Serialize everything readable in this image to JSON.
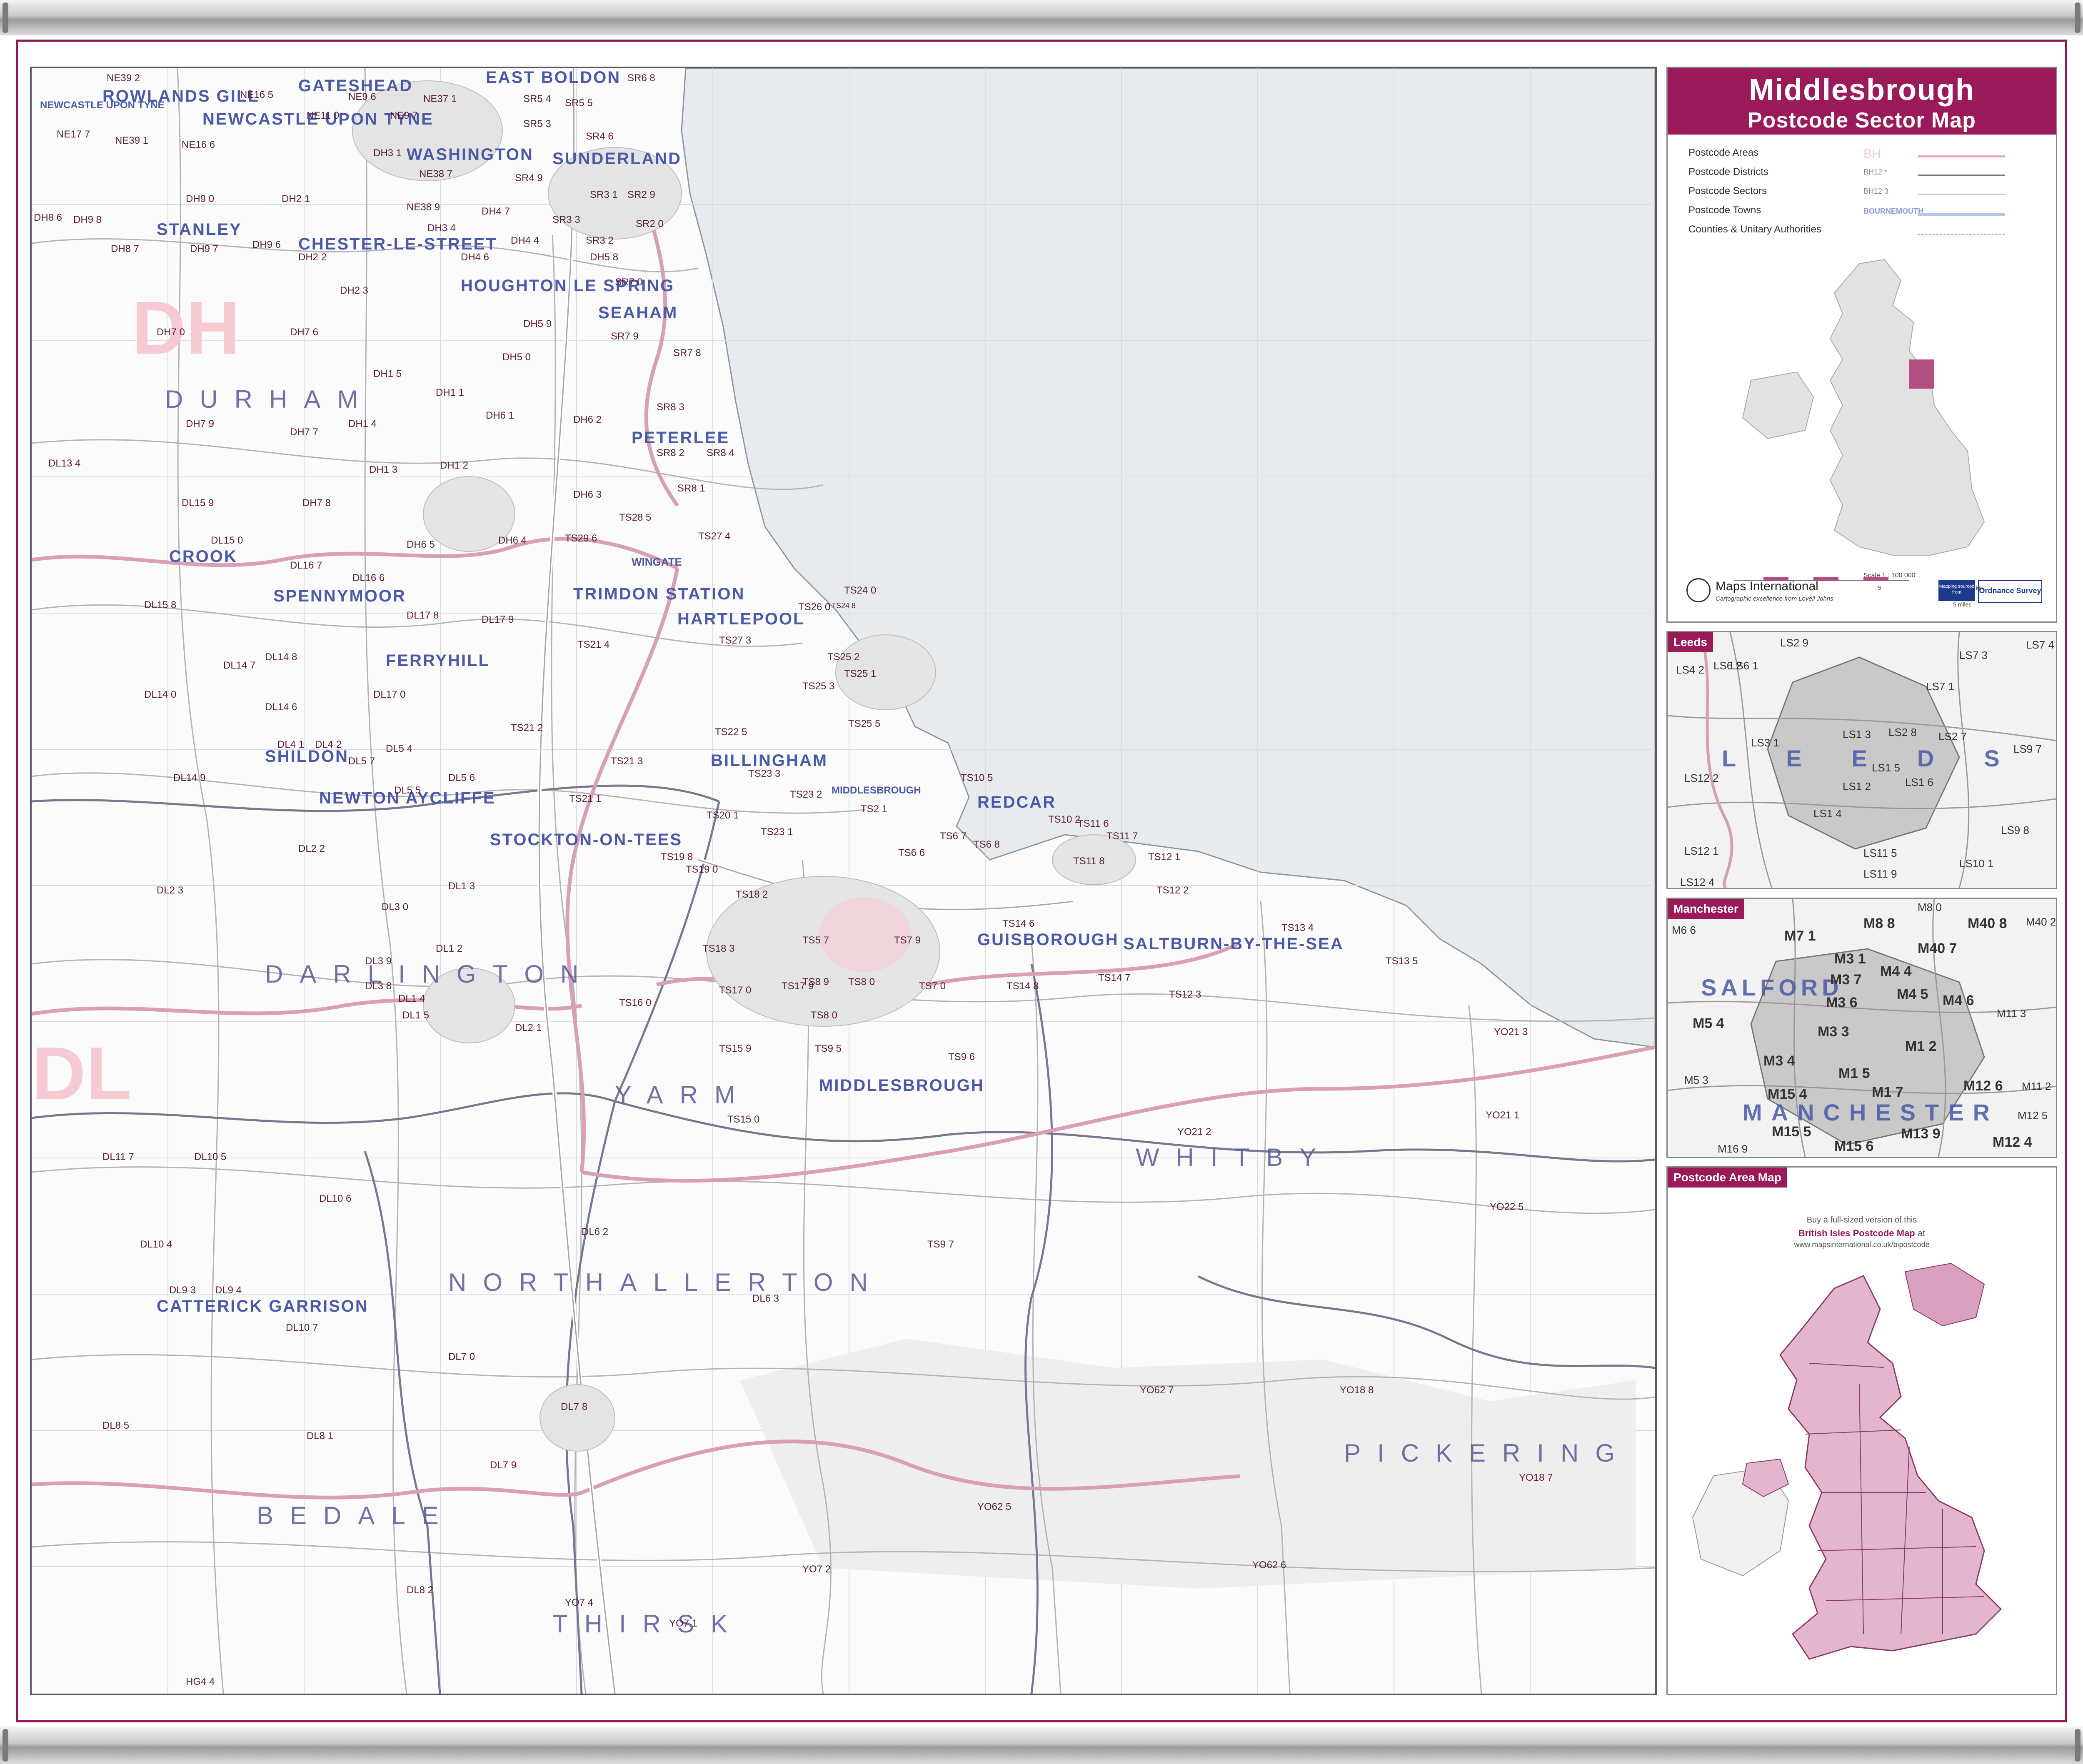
{
  "title": {
    "main": "Middlesbrough",
    "sub": "Postcode Sector Map"
  },
  "legend": {
    "rows": [
      {
        "label": "Postcode Areas",
        "sample": "BH",
        "color": "#e8a6bf"
      },
      {
        "label": "Postcode Districts",
        "sample": "BH12 *",
        "color": "#777777"
      },
      {
        "label": "Postcode Sectors",
        "sample": "BH12 3",
        "color": "#aaaaaa"
      },
      {
        "label": "Postcode Towns",
        "sample": "BOURNEMOUTH",
        "color": "#b8c4e8"
      },
      {
        "label": "Counties & Unitary Authorities",
        "sample": "",
        "color": "#cccccc"
      }
    ]
  },
  "locator": {
    "scale": "Scale 1 : 100 000",
    "ticks": [
      "0",
      "5",
      "10 km"
    ],
    "miles": "5 miles"
  },
  "brand": {
    "name": "Maps International",
    "tagline": "Cartographic excellence from Lovell Johns",
    "os_badge": "Ordnance Survey",
    "mapping_sourced": "Mapping sourced from"
  },
  "insets": {
    "leeds": {
      "tag": "Leeds",
      "town": "LEEDS",
      "sectors": [
        "LS2 9",
        "LS6 2",
        "LS7 3",
        "LS7 4",
        "LS6 1",
        "LS4 2",
        "LS7 1",
        "LS1 3",
        "LS2 8",
        "LS2 7",
        "LS3 1",
        "LS1 5",
        "LS9 7",
        "LS12 2",
        "LS1 2",
        "LS1 6",
        "LS1 4",
        "LS9 8",
        "LS12 1",
        "LS11 5",
        "LS10 1",
        "LS11 9",
        "LS12 4"
      ]
    },
    "manchester": {
      "tag": "Manchester",
      "towns": [
        "SALFORD",
        "MANCHESTER"
      ],
      "sectors": [
        "M8 8",
        "M8 0",
        "M40 8",
        "M40 2",
        "M6 6",
        "M7 1",
        "M3 1",
        "M40 7",
        "M3 7",
        "M4 4",
        "M3 6",
        "M4 5",
        "M4 6",
        "M5 4",
        "M11 3",
        "M3 3",
        "M1 2",
        "M3 4",
        "M1 5",
        "M5 3",
        "M15 4",
        "M1 7",
        "M12 6",
        "M11 2",
        "M15 5",
        "M13 9",
        "M12 5",
        "M15 6",
        "M12 4",
        "M16 9"
      ]
    },
    "area_map": {
      "tag": "Postcode Area Map",
      "text1": "Buy a full-sized version of this",
      "text2": "British Isles Postcode Map",
      "text3": "at",
      "url": "www.mapsinternational.co.uk/bipostcode"
    }
  },
  "map_labels": {
    "towns": [
      "GATESHEAD",
      "EAST BOLDON",
      "NEWCASTLE UPON TYNE",
      "ROWLANDS GILL",
      "NEWCASTLE UPON TYNE",
      "WASHINGTON",
      "SUNDERLAND",
      "STANLEY",
      "CHESTER-LE-STREET",
      "HOUGHTON LE SPRING",
      "SEAHAM",
      "PETERLEE",
      "SPENNYMOOR",
      "TRIMDON STATION",
      "HARTLEPOOL",
      "FERRYHILL",
      "SHILDON",
      "BILLINGHAM",
      "NEWTON AYCLIFFE",
      "MIDDLESBROUGH",
      "REDCAR",
      "STOCKTON-ON-TEES",
      "GUISBOROUGH",
      "SALTBURN-BY-THE-SEA",
      "MIDDLESBROUGH",
      "CATTERICK GARRISON",
      "CROOK",
      "WINGATE"
    ],
    "districts": [
      "DURHAM",
      "DARLINGTON",
      "YARM",
      "NORTHALLERTON",
      "WHITBY",
      "PICKERING",
      "BEDALE",
      "THIRSK"
    ],
    "areas": [
      "DH",
      "DL"
    ],
    "sectors": [
      "NE39 2",
      "NE16 5",
      "NE9 6",
      "NE37 1",
      "SR6 8",
      "NE17 7",
      "NE39 1",
      "NE16 6",
      "NE11 0",
      "NE9 7",
      "SR5 4",
      "SR5 5",
      "SR5 3",
      "SR4 6",
      "DH3 1",
      "NE38 7",
      "SR4 9",
      "SR3 1",
      "SR2 9",
      "DH9 0",
      "DH2 1",
      "NE38 9",
      "DH4 7",
      "SR3 3",
      "SR2 0",
      "DH8 6",
      "DH9 8",
      "DH9 6",
      "DH3 4",
      "DH4 4",
      "SR3 2",
      "DH8 7",
      "DH9 7",
      "DH2 2",
      "DH4 6",
      "DH5 8",
      "SR7 0",
      "DH2 3",
      "DH5 9",
      "DH7 0",
      "DH7 6",
      "SR7 9",
      "SR7 8",
      "DH5 0",
      "DH1 5",
      "DH1 1",
      "SR8 3",
      "DH6 1",
      "DH6 2",
      "DH7 9",
      "DH1 4",
      "SR8 2",
      "SR8 4",
      "DL13 4",
      "DH7 7",
      "DH1 3",
      "DH1 2",
      "SR8 1",
      "DL15 9",
      "DH7 8",
      "DH6 3",
      "TS28 5",
      "DH6 5",
      "DH6 4",
      "TS29 6",
      "TS27 4",
      "DL15 0",
      "DL16 7",
      "DL16 6",
      "TS24 0",
      "DL15 8",
      "DL17 8",
      "DL17 9",
      "TS26 0",
      "TS24 8",
      "TS27 3",
      "TS21 4",
      "TS25 2",
      "TS25 1",
      "DL14 7",
      "DL14 8",
      "DL17 0",
      "TS25 3",
      "DL14 0",
      "DL14 6",
      "TS25 5",
      "TS21 2",
      "TS22 5",
      "DL4 1",
      "DL4 2",
      "DL5 4",
      "DL5 7",
      "TS21 3",
      "TS23 3",
      "TS10 5",
      "DL14 9",
      "DL5 6",
      "DL5 5",
      "TS23 2",
      "TS23 1",
      "TS21 1",
      "TS2 1",
      "TS20 1",
      "TS10 2",
      "TS11 6",
      "TS11 7",
      "TS12 1",
      "DL2 2",
      "TS6 7",
      "TS6 8",
      "TS19 8",
      "TS19 0",
      "TS6 6",
      "TS11 8",
      "DL2 3",
      "DL1 3",
      "TS18 2",
      "TS12 2",
      "DL3 0",
      "TS13 4",
      "TS14 6",
      "DL1 2",
      "DL3 9",
      "TS18 3",
      "TS5 7",
      "TS7 9",
      "TS13 5",
      "TS8 9",
      "TS8 0",
      "TS14 8",
      "TS14 7",
      "DL3 8",
      "DL1 4",
      "TS17 0",
      "TS17 9",
      "TS7 0",
      "TS12 3",
      "DL1 5",
      "TS16 0",
      "DL2 1",
      "TS8 0",
      "YO21 3",
      "TS15 9",
      "TS9 5",
      "TS9 6",
      "TS15 0",
      "YO21 2",
      "YO21 1",
      "DL11 7",
      "DL10 5",
      "DL10 6",
      "YO22 5",
      "DL6 2",
      "TS9 7",
      "DL10 4",
      "DL9 3",
      "DL9 4",
      "DL6 3",
      "DL10 7",
      "DL7 0",
      "YO62 7",
      "YO18 8",
      "DL7 8",
      "DL8 5",
      "DL8 1",
      "DL7 9",
      "YO18 7",
      "YO62 5",
      "DL8 2",
      "YO7 2",
      "YO62 6",
      "YO7 4",
      "YO7 1",
      "HG4 4"
    ]
  }
}
